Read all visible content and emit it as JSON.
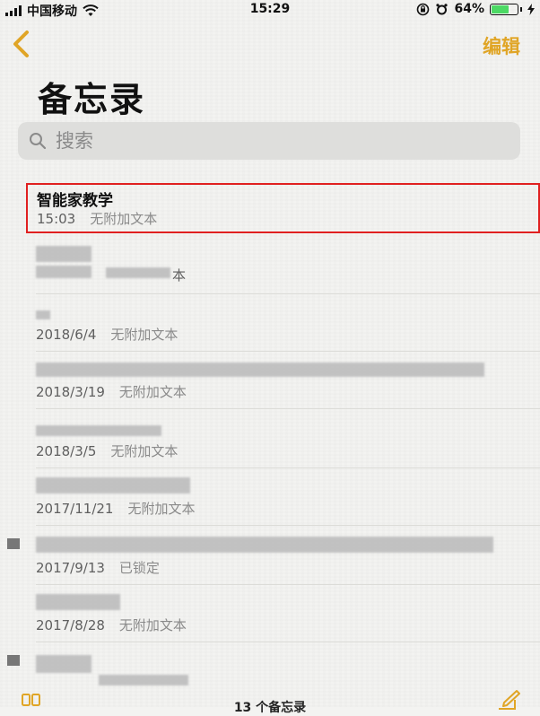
{
  "status": {
    "carrier": "中国移动",
    "time": "15:29",
    "battery_pct": "64%",
    "battery_level": 0.64,
    "icons": [
      "signal-icon",
      "wifi-icon",
      "orientation-lock-icon",
      "alarm-icon",
      "battery-icon",
      "charging-icon"
    ]
  },
  "nav": {
    "back_icon": "chevron-left-icon",
    "edit_label": "编辑",
    "accent_color": "#e0a526"
  },
  "page": {
    "title": "备忘录"
  },
  "search": {
    "placeholder": "搜索",
    "value": "",
    "icon": "search-icon"
  },
  "notes": [
    {
      "title": "智能家教学",
      "date": "15:03",
      "subtitle": "无附加文本",
      "selected": true
    },
    {
      "title": "",
      "date": "",
      "subtitle": "本",
      "redacted": true
    },
    {
      "title": "",
      "date": "2018/6/4",
      "subtitle": "无附加文本",
      "redacted": true
    },
    {
      "title": "",
      "date": "2018/3/19",
      "subtitle": "无附加文本",
      "redacted": true
    },
    {
      "title": "",
      "date": "2018/3/5",
      "subtitle": "无附加文本",
      "redacted": true
    },
    {
      "title": "",
      "date": "2017/11/21",
      "subtitle": "无附加文本",
      "redacted": true
    },
    {
      "title": "",
      "date": "2017/9/13",
      "subtitle": "已锁定",
      "redacted": true
    },
    {
      "title": "",
      "date": "2017/8/28",
      "subtitle": "无附加文本",
      "redacted": true
    },
    {
      "title": "",
      "date": "",
      "subtitle": "",
      "redacted": true
    }
  ],
  "footer": {
    "count_label": "13 个备忘录",
    "folder_icon": "folders-icon",
    "compose_icon": "compose-icon"
  },
  "colors": {
    "selection_border": "#e02020",
    "battery_fill": "#4cd964"
  }
}
